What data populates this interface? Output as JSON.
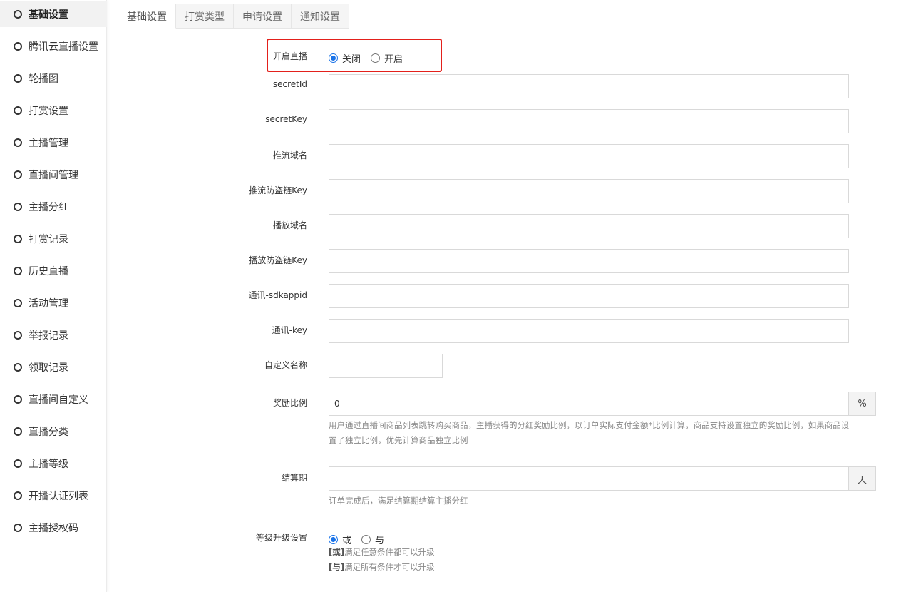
{
  "sidebar": {
    "items": [
      {
        "label": "基础设置",
        "active": true
      },
      {
        "label": "腾讯云直播设置"
      },
      {
        "label": "轮播图"
      },
      {
        "label": "打赏设置"
      },
      {
        "label": "主播管理"
      },
      {
        "label": "直播间管理"
      },
      {
        "label": "主播分红"
      },
      {
        "label": "打赏记录"
      },
      {
        "label": "历史直播"
      },
      {
        "label": "活动管理"
      },
      {
        "label": "举报记录"
      },
      {
        "label": "领取记录"
      },
      {
        "label": "直播间自定义"
      },
      {
        "label": "直播分类"
      },
      {
        "label": "主播等级"
      },
      {
        "label": "开播认证列表"
      },
      {
        "label": "主播授权码"
      }
    ]
  },
  "tabs": [
    {
      "label": "基础设置",
      "active": true
    },
    {
      "label": "打赏类型"
    },
    {
      "label": "申请设置"
    },
    {
      "label": "通知设置"
    }
  ],
  "form": {
    "live_switch": {
      "label": "开启直播",
      "options": [
        "关闭",
        "开启"
      ],
      "selected": "关闭"
    },
    "secret_id": {
      "label": "secretId",
      "value": ""
    },
    "secret_key": {
      "label": "secretKey",
      "value": ""
    },
    "push_domain": {
      "label": "推流域名",
      "value": ""
    },
    "push_key": {
      "label": "推流防盗链Key",
      "value": ""
    },
    "play_domain": {
      "label": "播放域名",
      "value": ""
    },
    "play_key": {
      "label": "播放防盗链Key",
      "value": ""
    },
    "sdkappid": {
      "label": "通讯-sdkappid",
      "value": ""
    },
    "im_key": {
      "label": "通讯-key",
      "value": ""
    },
    "custom_name": {
      "label": "自定义名称",
      "value": ""
    },
    "reward_ratio": {
      "label": "奖励比例",
      "value": "0",
      "addon": "%",
      "help_line1": "用户通过直播间商品列表跳转购买商品，主播获得的分红奖励比例，以订单实际支付金额*比例计算，商品支持设置独立的奖励比例，如果商品设",
      "help_line2": "置了独立比例，优先计算商品独立比例"
    },
    "settle_period": {
      "label": "结算期",
      "value": "",
      "addon": "天",
      "help": "订单完成后，满足结算期结算主播分红"
    },
    "level_upgrade": {
      "label": "等级升级设置",
      "options": [
        "或",
        "与"
      ],
      "selected": "或",
      "rule_or_tag": "[或]",
      "rule_or_text": "满足任意条件都可以升级",
      "rule_and_tag": "[与]",
      "rule_and_text": "满足所有条件才可以升级"
    }
  },
  "colors": {
    "accent": "#1a73e8",
    "highlight_border": "#e3201b",
    "sidebar_active_bg": "#f2f2f2"
  },
  "icons": {
    "sidebar_item": "circle-icon"
  }
}
